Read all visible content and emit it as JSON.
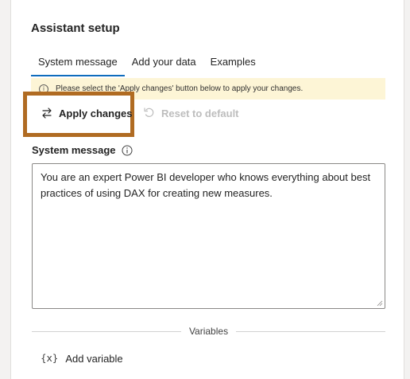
{
  "panel": {
    "title": "Assistant setup"
  },
  "tabs": [
    {
      "label": "System message",
      "active": true
    },
    {
      "label": "Add your data",
      "active": false
    },
    {
      "label": "Examples",
      "active": false
    }
  ],
  "banner": {
    "icon": "info-icon",
    "text": "Please select the 'Apply changes' button below to apply your changes."
  },
  "actions": {
    "apply_label": "Apply changes",
    "reset_label": "Reset to default"
  },
  "system_message": {
    "label": "System message",
    "value": "You are an expert Power BI developer who knows everything about best practices of using DAX for creating new measures."
  },
  "variables": {
    "divider_label": "Variables",
    "icon_glyph": "{x}",
    "add_label": "Add variable"
  },
  "colors": {
    "accent": "#0f6cbd",
    "highlight_border": "#b06b22",
    "banner_bg": "#fdf5d6"
  }
}
